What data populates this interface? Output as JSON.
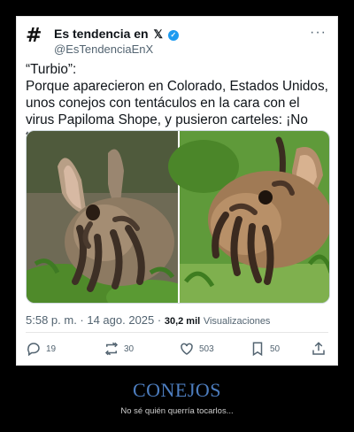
{
  "tweet": {
    "account_name": "Es tendencia en",
    "x_glyph": "𝕏",
    "verified_glyph": "✓",
    "handle": "@EsTendenciaEnX",
    "more_glyph": "···",
    "hash_glyph": "#",
    "text_line1": "“Turbio”:",
    "text_body": "Porque aparecieron en Colorado, Estados Unidos, unos conejos con tentáculos en la cara con el virus Papiloma Shope, y pusieron carteles: ¡No tocar!",
    "timestamp": "5:58 p. m. · 14 ago. 2025 · ",
    "views_count": "30,2 mil",
    "views_label": "Visualizaciones",
    "replies": "19",
    "reposts": "30",
    "likes": "503",
    "bookmarks": "50"
  },
  "icons": {
    "reply": "reply-icon",
    "repost": "repost-icon",
    "like": "heart-icon",
    "bookmark": "bookmark-icon",
    "share": "share-icon"
  },
  "caption": {
    "title": "CONEJOS",
    "subtitle": "No sé quién querría tocarlos..."
  },
  "colors": {
    "background": "#000000",
    "caption_title": "#4d7ec0",
    "verified_blue": "#1d9bf0"
  }
}
